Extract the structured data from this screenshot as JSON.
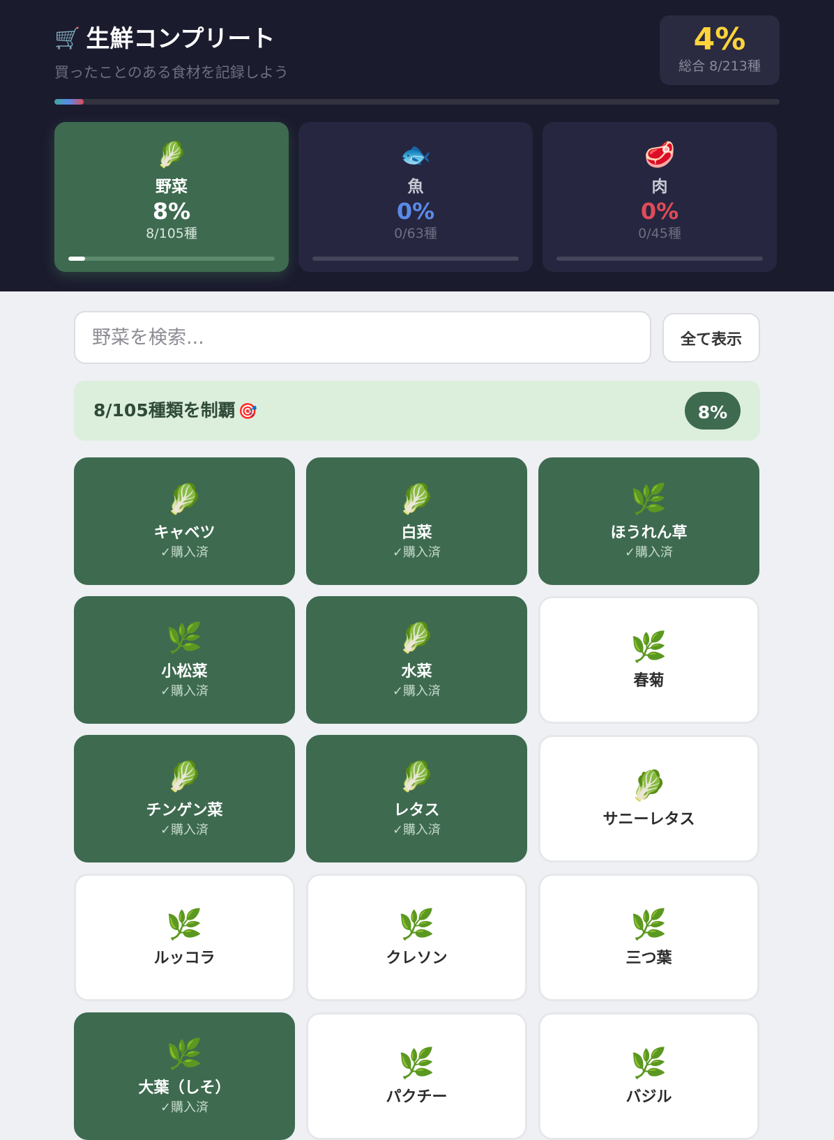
{
  "header": {
    "cart_icon": "🛒",
    "title": "生鮮コンプリート",
    "subtitle": "買ったことのある食材を記録しよう",
    "total_percent": "4%",
    "total_count": "総合 8/213種",
    "overall_progress": 0.04
  },
  "categories": [
    {
      "icon": "🥬",
      "icon_name": "leafy-greens-icon",
      "name": "野菜",
      "percent": "8%",
      "count": "8/105種",
      "color": "#ffffff",
      "progress": 0.08,
      "active": true
    },
    {
      "icon": "🐟",
      "icon_name": "fish-icon",
      "name": "魚",
      "percent": "0%",
      "count": "0/63種",
      "color": "#5a8ae8",
      "progress": 0.0,
      "active": false
    },
    {
      "icon": "🥩",
      "icon_name": "meat-icon",
      "name": "肉",
      "percent": "0%",
      "count": "0/45種",
      "color": "#e04b57",
      "progress": 0.0,
      "active": false
    }
  ],
  "search": {
    "placeholder": "野菜を検索...",
    "value": "",
    "show_all_label": "全て表示"
  },
  "banner": {
    "text": "8/105種類を制覇",
    "icon": "🎯",
    "badge": "8%"
  },
  "colors": {
    "accent_green": "#3e6a50",
    "header_bg": "#1b1b2e",
    "total_yellow": "#ffd43b"
  },
  "purchased_label": "✓購入済",
  "items": [
    {
      "icon": "🥬",
      "icon_name": "leafy-greens-icon",
      "name": "キャベツ",
      "purchased": true
    },
    {
      "icon": "🥬",
      "icon_name": "leafy-greens-icon",
      "name": "白菜",
      "purchased": true
    },
    {
      "icon": "🌿",
      "icon_name": "herb-icon",
      "name": "ほうれん草",
      "purchased": true
    },
    {
      "icon": "🌿",
      "icon_name": "herb-icon",
      "name": "小松菜",
      "purchased": true
    },
    {
      "icon": "🥬",
      "icon_name": "leafy-greens-icon",
      "name": "水菜",
      "purchased": true
    },
    {
      "icon": "🌿",
      "icon_name": "herb-icon",
      "name": "春菊",
      "purchased": false
    },
    {
      "icon": "🥬",
      "icon_name": "leafy-greens-icon",
      "name": "チンゲン菜",
      "purchased": true
    },
    {
      "icon": "🥬",
      "icon_name": "leafy-greens-icon",
      "name": "レタス",
      "purchased": true
    },
    {
      "icon": "🥬",
      "icon_name": "leafy-greens-icon",
      "name": "サニーレタス",
      "purchased": false
    },
    {
      "icon": "🌿",
      "icon_name": "herb-icon",
      "name": "ルッコラ",
      "purchased": false
    },
    {
      "icon": "🌿",
      "icon_name": "herb-icon",
      "name": "クレソン",
      "purchased": false
    },
    {
      "icon": "🌿",
      "icon_name": "herb-icon",
      "name": "三つ葉",
      "purchased": false
    },
    {
      "icon": "🌿",
      "icon_name": "herb-icon",
      "name": "大葉（しそ）",
      "purchased": true
    },
    {
      "icon": "🌿",
      "icon_name": "herb-icon",
      "name": "パクチー",
      "purchased": false
    },
    {
      "icon": "🌿",
      "icon_name": "herb-icon",
      "name": "バジル",
      "purchased": false
    }
  ]
}
